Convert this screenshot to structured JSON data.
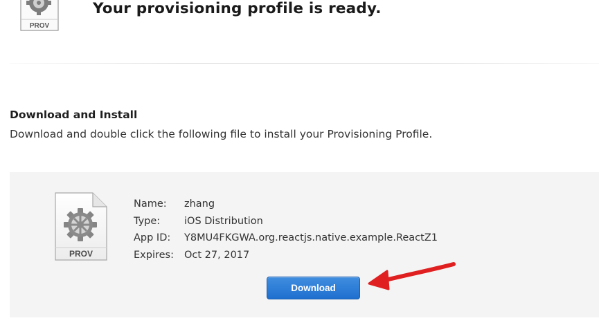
{
  "header": {
    "title": "Your provisioning profile is ready.",
    "icon": "provisioning-profile-icon",
    "icon_label": "PROV"
  },
  "section": {
    "heading": "Download and Install",
    "description": "Download and double click the following file to install your Provisioning Profile."
  },
  "profile": {
    "icon": "provisioning-profile-file-icon",
    "icon_label": "PROV",
    "fields": [
      {
        "label": "Name:",
        "value": "zhang"
      },
      {
        "label": "Type:",
        "value": "iOS Distribution"
      },
      {
        "label": "App ID:",
        "value": "Y8MU4FKGWA.org.reactjs.native.example.ReactZ1"
      },
      {
        "label": "Expires:",
        "value": "Oct 27, 2017"
      }
    ]
  },
  "actions": {
    "download_label": "Download"
  },
  "annotation": {
    "icon": "red-arrow-annotation",
    "color": "#e02020"
  },
  "colors": {
    "button": "#2a79d6",
    "panel": "#f4f4f4"
  }
}
